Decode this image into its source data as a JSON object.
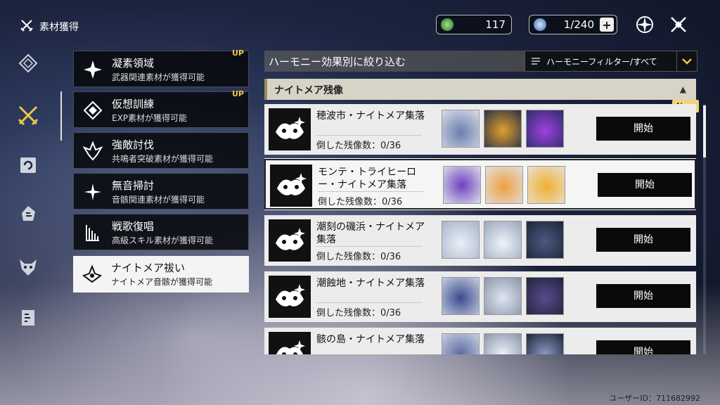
{
  "header": {
    "title": "素材獲得",
    "currency1": {
      "value": "117",
      "icon": "green-crystal-icon"
    },
    "currency2": {
      "value": "1/240",
      "icon": "blue-crystal-icon"
    }
  },
  "side_nav": [
    "compass-icon",
    "swords-icon",
    "refresh-box-icon",
    "fist-icon",
    "demon-mask-icon",
    "book-icon"
  ],
  "categories": [
    {
      "name": "凝素領域",
      "desc": "武器関連素材が獲得可能",
      "badge": "UP"
    },
    {
      "name": "仮想訓練",
      "desc": "EXP素材が獲得可能",
      "badge": "UP"
    },
    {
      "name": "強敵討伐",
      "desc": "共鳴者突破素材が獲得可能",
      "badge": ""
    },
    {
      "name": "無音掃討",
      "desc": "音骸関連素材が獲得可能",
      "badge": ""
    },
    {
      "name": "戦歌復唱",
      "desc": "高級スキル素材が獲得可能",
      "badge": ""
    },
    {
      "name": "ナイトメア祓い",
      "desc": "ナイトメア音骸が獲得可能",
      "badge": ""
    }
  ],
  "filter": {
    "title": "ハーモニー効果別に絞り込む",
    "dropdown_label": "ハーモニーフィルター/すべて"
  },
  "section": {
    "title": "ナイトメア残像",
    "new_badge": "New"
  },
  "rows": [
    {
      "name": "穂波市・ナイトメア集落",
      "count": "倒した残像数：0/36",
      "start": "開始"
    },
    {
      "name": "モンテ・トライヒーロー・ナイトメア集落",
      "count": "倒した残像数：0/36",
      "start": "開始"
    },
    {
      "name": "潮刻の磯浜・ナイトメア集落",
      "count": "倒した残像数：0/36",
      "start": "開始"
    },
    {
      "name": "潮蝕地・ナイトメア集落",
      "count": "倒した残像数：0/36",
      "start": "開始"
    },
    {
      "name": "骸の島・ナイトメア集落",
      "count": "",
      "start": "開始"
    }
  ],
  "footer": {
    "uid": "ユーザーID：711682992"
  },
  "colors": {
    "accent": "#f0c64a",
    "row_bg": "#ececec",
    "button": "#0a0a0a"
  }
}
